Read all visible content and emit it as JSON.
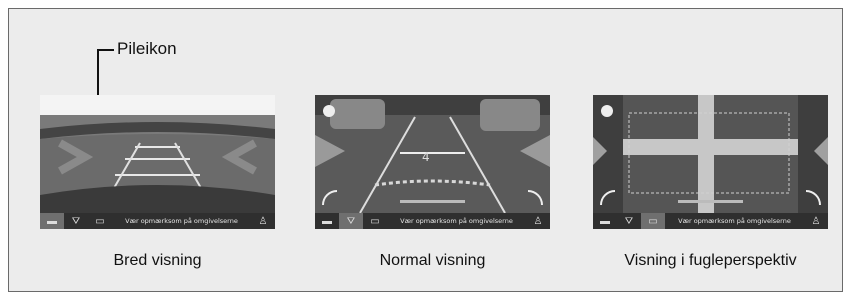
{
  "callout": {
    "label": "Pileikon"
  },
  "views": [
    {
      "caption": "Bred visning",
      "status_message": "Vær opmærksom på omgivelserne"
    },
    {
      "caption": "Normal visning",
      "status_message": "Vær opmærksom på omgivelserne"
    },
    {
      "caption": "Visning i fugleperspektiv",
      "status_message": "Vær opmærksom på omgivelserne"
    }
  ],
  "colors": {
    "panel_background": "#ececec",
    "border": "#6a6a6a",
    "toolbar": "#2f2f2f",
    "active_button": "#6f6f6f"
  },
  "icons": [
    "wide-view-icon",
    "normal-view-icon",
    "top-view-icon",
    "parking-sensor-icon",
    "arrow-icon"
  ]
}
